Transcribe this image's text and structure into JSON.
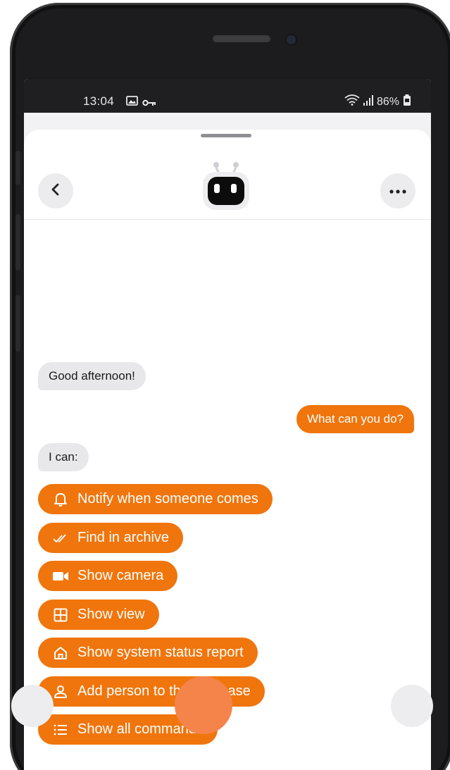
{
  "status_bar": {
    "time": "13:04",
    "battery": "86%",
    "icons": [
      "image-icon",
      "key-icon",
      "wifi-icon",
      "signal-icon",
      "battery-icon"
    ]
  },
  "header": {
    "back_icon": "chevron-left-icon",
    "more_icon": "more-horizontal-icon",
    "avatar": "robot-icon"
  },
  "chat": {
    "messages": [
      {
        "from": "bot",
        "text": "Good afternoon!"
      },
      {
        "from": "user",
        "text": "What can you do?"
      },
      {
        "from": "bot",
        "text": "I can:"
      }
    ],
    "commands": [
      {
        "icon": "bell-icon",
        "label": "Notify when someone comes"
      },
      {
        "icon": "double-check-icon",
        "label": "Find in archive"
      },
      {
        "icon": "video-camera-icon",
        "label": "Show camera"
      },
      {
        "icon": "grid-icon",
        "label": "Show view"
      },
      {
        "icon": "home-icon",
        "label": "Show system status report"
      },
      {
        "icon": "person-icon",
        "label": "Add person to the database"
      },
      {
        "icon": "list-icon",
        "label": "Show all commands"
      }
    ]
  },
  "colors": {
    "accent": "#f0750c",
    "bubble_grey": "#e8e8ea",
    "bezel": "#1c1c1e"
  }
}
